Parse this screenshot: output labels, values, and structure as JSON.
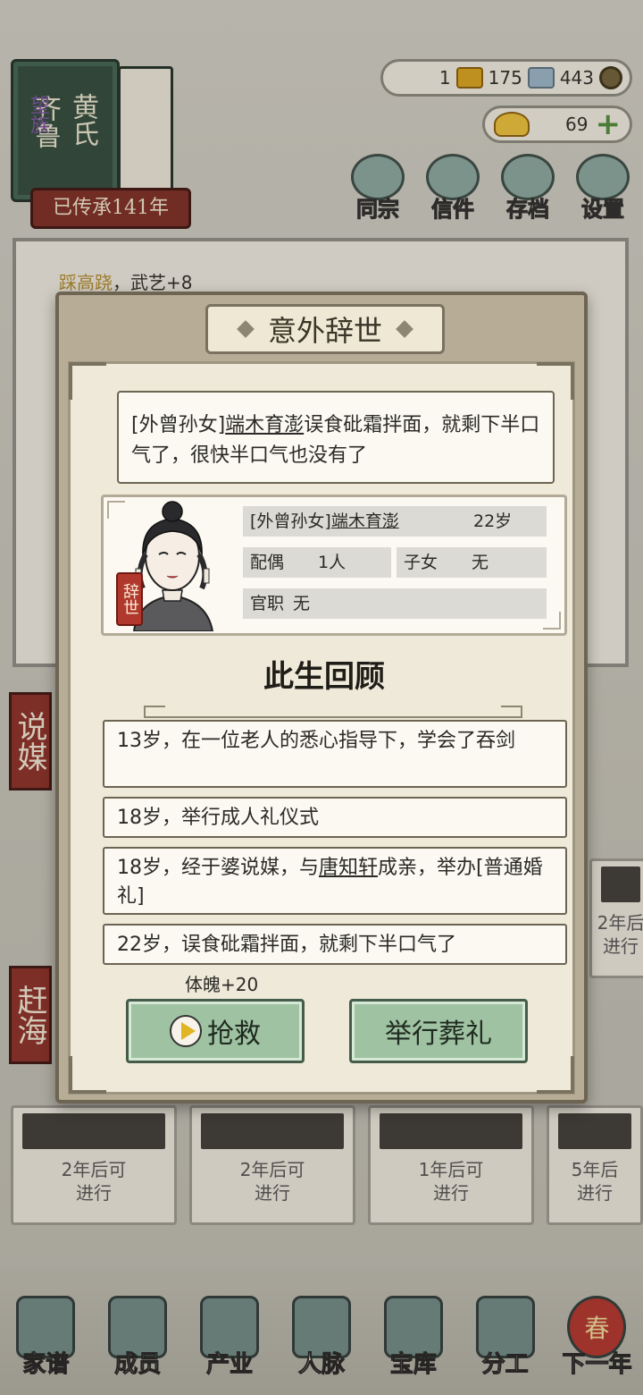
{
  "clan": {
    "surname_line1": "齐鲁",
    "surname_line2": "黄氏",
    "rank": "望族",
    "inherited": "已传承141年"
  },
  "resources": {
    "gold": "1",
    "silver": "175",
    "coins": "443",
    "ingots": "69"
  },
  "top_menu": [
    "同宗",
    "信件",
    "存档",
    "设置"
  ],
  "background_log": {
    "highlight": "踩高跷",
    "text": "，武艺+8"
  },
  "side_cards": [
    "说媒",
    "赶海"
  ],
  "activity_cards": [
    {
      "label": "2年后\n进行"
    },
    {
      "label": "2年后可\n进行"
    },
    {
      "label": "2年后可\n进行"
    },
    {
      "label": "1年后可\n进行"
    },
    {
      "label": "5年后\n进行"
    }
  ],
  "bottom_nav": [
    "家谱",
    "成员",
    "产业",
    "人脉",
    "宝库",
    "分工",
    "下一年"
  ],
  "bottom_nav_badge": "春",
  "modal": {
    "title": "意外辞世",
    "event": {
      "prefix": "[外曾孙女]",
      "name": "端木育澎",
      "suffix": "误食砒霜拌面，就剩下半口气了，很快半口气也没有了"
    },
    "profile": {
      "relation": "[外曾孙女]",
      "name": "端木育澎",
      "age": "22岁",
      "spouse_label": "配偶",
      "spouse_value": "1人",
      "children_label": "子女",
      "children_value": "无",
      "office_label": "官职",
      "office_value": "无",
      "status_stamp": "辞世"
    },
    "review_title": "此生回顾",
    "life_events": [
      {
        "text": "13岁，在一位老人的悉心指导下，学会了吞剑"
      },
      {
        "text": "18岁，举行成人礼仪式"
      },
      {
        "prefix": "18岁，经于婆说媒，与",
        "name": "唐知轩",
        "suffix": "成亲，举办[普通婚礼]"
      },
      {
        "text": "22岁，误食砒霜拌面，就剩下半口气了"
      }
    ],
    "stat_gain": "体魄+20",
    "rescue_button": "抢救",
    "funeral_button": "举行葬礼"
  },
  "colors": {
    "button_green": "#9fc2a2",
    "stamp_red": "#b0382c",
    "panel_bg": "#eee9d9"
  }
}
